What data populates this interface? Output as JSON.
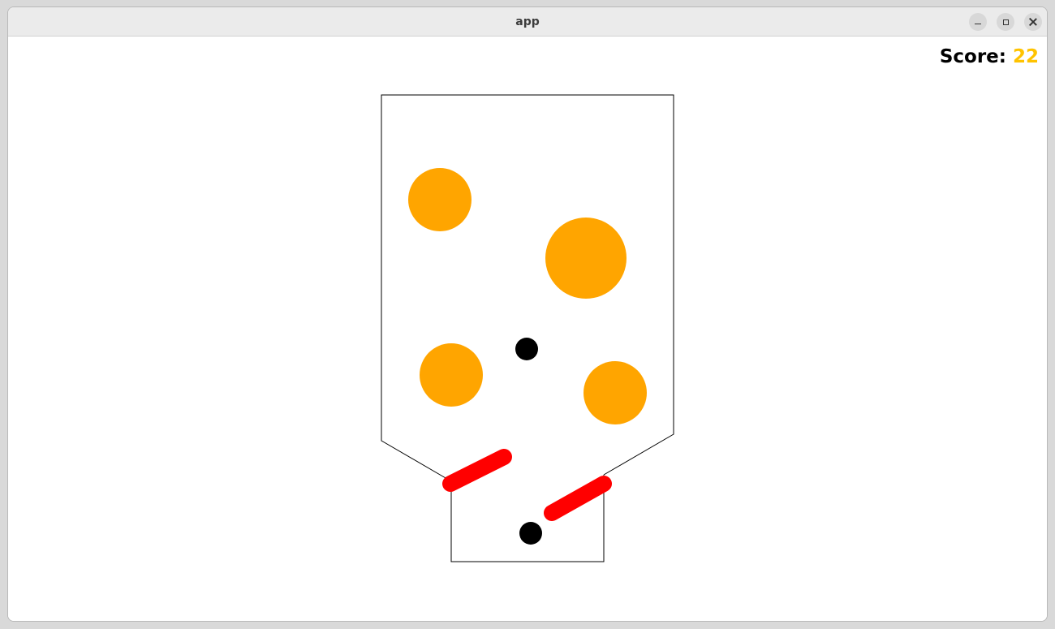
{
  "window": {
    "title": "app"
  },
  "hud": {
    "score_label": "Score: ",
    "score_value": "22"
  },
  "colors": {
    "bumper": "#ffa500",
    "flipper": "#ff0000",
    "ball": "#000000",
    "score_value": "#ffc300",
    "wall": "#000000"
  },
  "game": {
    "bumper_count": 4,
    "flipper_count": 2,
    "ball_count": 2
  }
}
